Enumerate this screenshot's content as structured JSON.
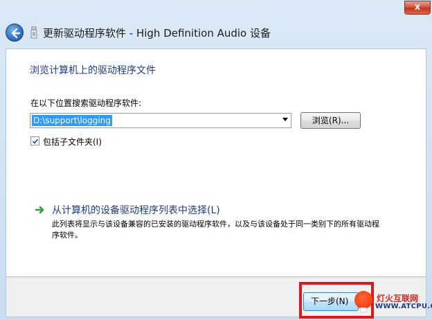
{
  "window": {
    "title": "更新驱动程序软件 - High Definition Audio 设备",
    "close_label": "x"
  },
  "page": {
    "heading": "浏览计算机上的驱动程序文件",
    "search_label": "在以下位置搜索驱动程序软件:",
    "path_value": "D:\\support\\logging",
    "browse_label": "浏览(R)...",
    "include_subfolders": {
      "label": "包括子文件夹(I)",
      "checked": true
    },
    "pick_link": {
      "title": "从计算机的设备驱动程序列表中选择(L)",
      "description": "此列表将显示与该设备兼容的已安装的驱动程序软件，以及与该设备处于同一类别下的所有驱动程序软件。"
    }
  },
  "footer": {
    "next_label": "下一步(N)"
  },
  "watermark": {
    "name": "灯火互联网",
    "url": "WWW.ATCPU.COM"
  },
  "colors": {
    "heading_blue": "#1e3b8a",
    "selection_blue": "#3399ff",
    "highlight_red": "#e0161d",
    "link_arrow_green": "#2e9e3a"
  },
  "icons": {
    "back": "back-arrow-icon",
    "device": "usb-device-icon",
    "link": "green-arrow-icon",
    "check": "checkmark-icon",
    "dropdown": "chevron-down-icon"
  }
}
